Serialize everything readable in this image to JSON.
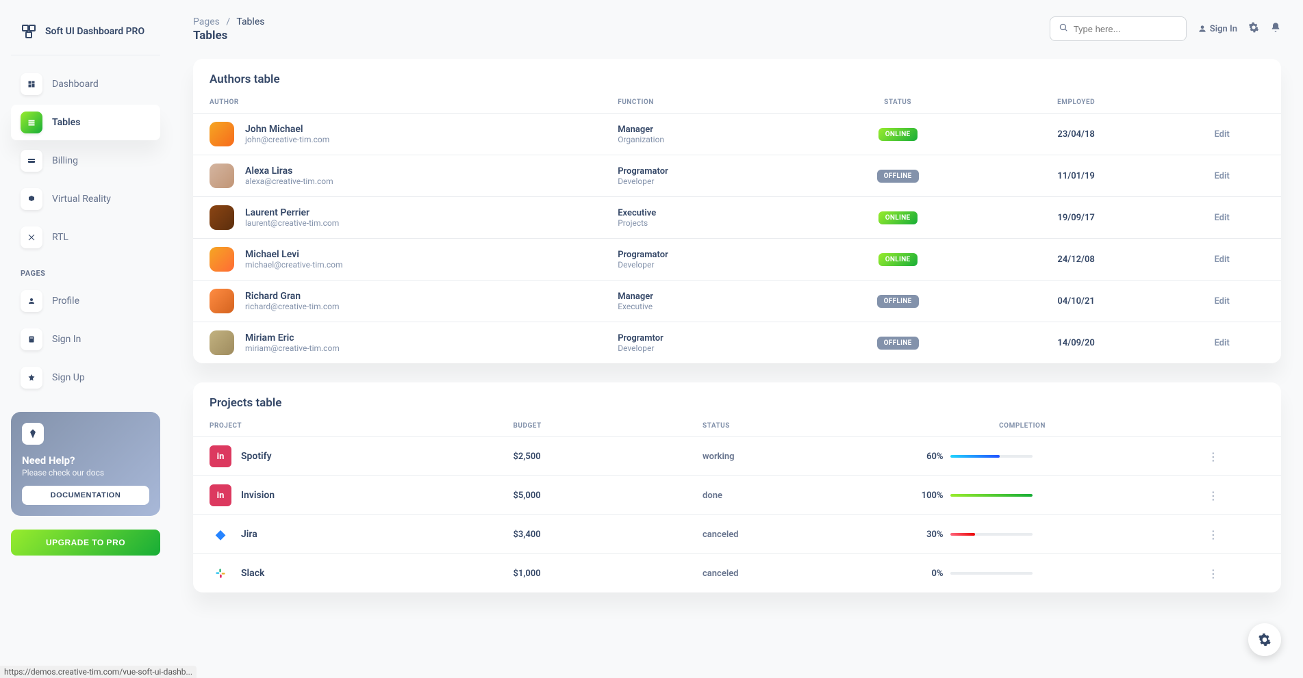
{
  "brand": "Soft UI Dashboard PRO",
  "breadcrumb": {
    "root": "Pages",
    "current": "Tables"
  },
  "page_title": "Tables",
  "search": {
    "placeholder": "Type here..."
  },
  "top": {
    "signin": "Sign In"
  },
  "sidebar": {
    "items": [
      {
        "label": "Dashboard"
      },
      {
        "label": "Tables"
      },
      {
        "label": "Billing"
      },
      {
        "label": "Virtual Reality"
      },
      {
        "label": "RTL"
      }
    ],
    "section": "PAGES",
    "pages": [
      {
        "label": "Profile"
      },
      {
        "label": "Sign In"
      },
      {
        "label": "Sign Up"
      }
    ],
    "help": {
      "title": "Need Help?",
      "sub": "Please check our docs",
      "btn": "DOCUMENTATION"
    },
    "upgrade": "UPGRADE TO PRO"
  },
  "authors_table": {
    "title": "Authors table",
    "headers": {
      "author": "AUTHOR",
      "function": "FUNCTION",
      "status": "STATUS",
      "employed": "EMPLOYED"
    },
    "edit_label": "Edit",
    "rows": [
      {
        "name": "John Michael",
        "email": "john@creative-tim.com",
        "role": "Manager",
        "dept": "Organization",
        "status": "ONLINE",
        "date": "23/04/18"
      },
      {
        "name": "Alexa Liras",
        "email": "alexa@creative-tim.com",
        "role": "Programator",
        "dept": "Developer",
        "status": "OFFLINE",
        "date": "11/01/19"
      },
      {
        "name": "Laurent Perrier",
        "email": "laurent@creative-tim.com",
        "role": "Executive",
        "dept": "Projects",
        "status": "ONLINE",
        "date": "19/09/17"
      },
      {
        "name": "Michael Levi",
        "email": "michael@creative-tim.com",
        "role": "Programator",
        "dept": "Developer",
        "status": "ONLINE",
        "date": "24/12/08"
      },
      {
        "name": "Richard Gran",
        "email": "richard@creative-tim.com",
        "role": "Manager",
        "dept": "Executive",
        "status": "OFFLINE",
        "date": "04/10/21"
      },
      {
        "name": "Miriam Eric",
        "email": "miriam@creative-tim.com",
        "role": "Programtor",
        "dept": "Developer",
        "status": "OFFLINE",
        "date": "14/09/20"
      }
    ]
  },
  "projects_table": {
    "title": "Projects table",
    "headers": {
      "project": "PROJECT",
      "budget": "BUDGET",
      "status": "STATUS",
      "completion": "COMPLETION"
    },
    "rows": [
      {
        "name": "Spotify",
        "budget": "$2,500",
        "status": "working",
        "pct": "60%",
        "pctv": 60,
        "color": "blue",
        "icon": "invision"
      },
      {
        "name": "Invision",
        "budget": "$5,000",
        "status": "done",
        "pct": "100%",
        "pctv": 100,
        "color": "green",
        "icon": "invision"
      },
      {
        "name": "Jira",
        "budget": "$3,400",
        "status": "canceled",
        "pct": "30%",
        "pctv": 30,
        "color": "red",
        "icon": "jira"
      },
      {
        "name": "Slack",
        "budget": "$1,000",
        "status": "canceled",
        "pct": "0%",
        "pctv": 0,
        "color": "blue",
        "icon": "slack"
      }
    ]
  },
  "status_url": "https://demos.creative-tim.com/vue-soft-ui-dashb..."
}
